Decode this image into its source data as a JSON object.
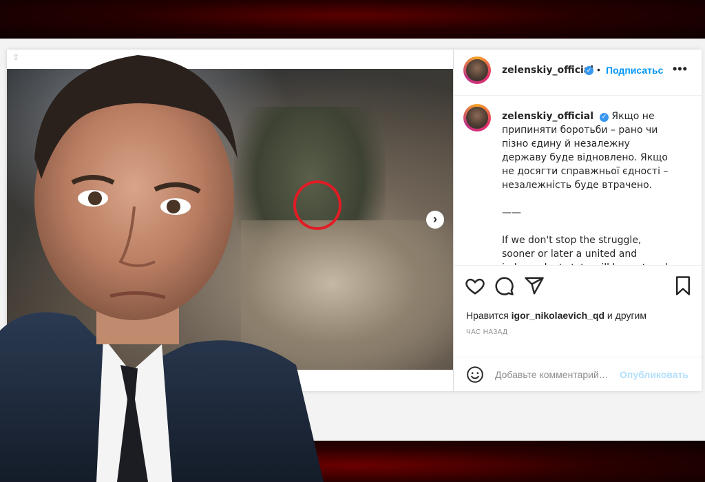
{
  "post": {
    "username": "zelenskiy_official",
    "follow_label": "Подписатьс",
    "more_label": "•••",
    "separator": "•",
    "caption": "Якщо не припиняти боротьби – рано чи пізно єдину й незалежну державу буде відновлено. Якщо не досягти справжньої єдності – незалежність буде втрачено.\n\n——\n\nIf we don't stop the struggle, sooner or later a united and independent state will be restored. If true unity is not achieved, independence will be",
    "likes_prefix": "Нравится ",
    "likes_user": "igor_nikolaevich_qd",
    "likes_suffix": " и другим",
    "time": "ЧАС НАЗАД",
    "comment_placeholder": "Добавьте комментарий…",
    "publish_label": "Опубликовать",
    "next_arrow": "›",
    "verified_check": "✓"
  },
  "colors": {
    "accent_blue": "#0095f6",
    "verified_blue": "#3897f0",
    "highlight_red": "#e21b24",
    "background_red": "#5a0000"
  },
  "icons": [
    "heart-icon",
    "comment-icon",
    "share-icon",
    "bookmark-icon",
    "emoji-icon",
    "chevron-right-icon",
    "verified-icon",
    "more-icon"
  ]
}
